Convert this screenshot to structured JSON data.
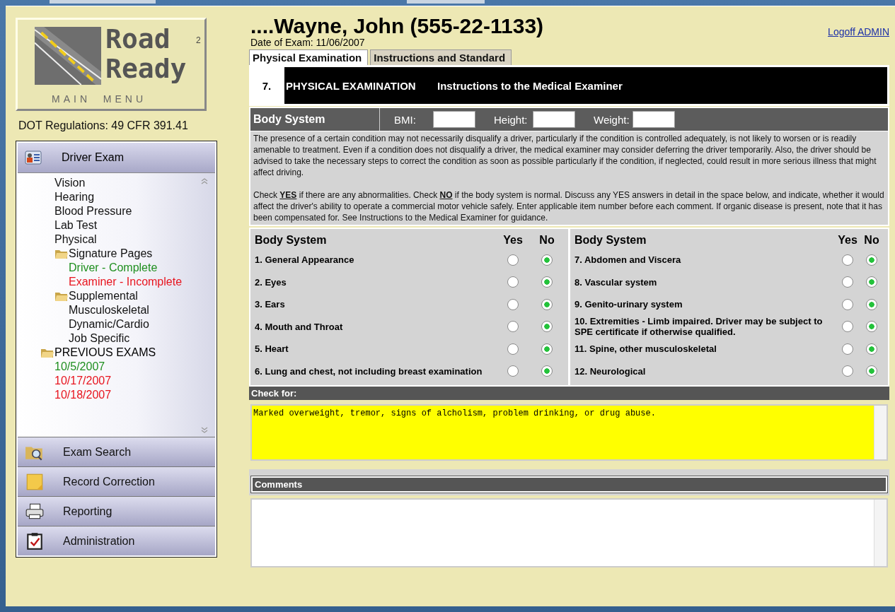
{
  "logo": {
    "line_1": "Road",
    "line_2": "Ready",
    "superscript": "2",
    "caption": "MAIN  MENU"
  },
  "regulation": "DOT Regulations: 49 CFR 391.41",
  "nav": {
    "header": "Driver Exam",
    "exam_items": [
      {
        "label": "Vision"
      },
      {
        "label": "Hearing"
      },
      {
        "label": "Blood Pressure"
      },
      {
        "label": "Lab Test"
      },
      {
        "label": "Physical"
      },
      {
        "label": "Signature Pages",
        "kind": "folder",
        "children": [
          {
            "label": "Driver - Complete",
            "color": "#1f8f1f"
          },
          {
            "label": "Examiner - Incomplete",
            "color": "#e8141e"
          }
        ]
      },
      {
        "label": "Supplemental",
        "kind": "folder",
        "children": [
          {
            "label": "Musculoskeletal"
          },
          {
            "label": "Dynamic/Cardio"
          },
          {
            "label": "Job Specific"
          }
        ]
      }
    ],
    "previous_exams": {
      "label": "PREVIOUS EXAMS",
      "children": [
        {
          "label": "10/5/2007",
          "color": "#1f8f1f"
        },
        {
          "label": "10/17/2007",
          "color": "#e8141e"
        },
        {
          "label": "10/18/2007",
          "color": "#e8141e"
        }
      ]
    },
    "buttons": [
      {
        "label": "Exam Search",
        "kind": "search"
      },
      {
        "label": "Record Correction",
        "kind": "note"
      },
      {
        "label": "Reporting",
        "kind": "printer"
      },
      {
        "label": "Administration",
        "kind": "clipboard"
      }
    ]
  },
  "patient": {
    "name": "....Wayne, John (555-22-1133)",
    "exam_date": "Date of Exam: 11/06/2007"
  },
  "logoff": "Logoff ADMIN",
  "tabs": [
    {
      "label": "Physical Examination",
      "selected": true
    },
    {
      "label": "Instructions and Standard",
      "selected": false
    }
  ],
  "banner": {
    "number": "7.",
    "title": "PHYSICAL EXAMINATION",
    "subtitle": "Instructions to the Medical Examiner"
  },
  "measures": {
    "heading": "Body System",
    "fields": [
      {
        "label": "BMI:"
      },
      {
        "label": "Height:"
      },
      {
        "label": "Weight:"
      }
    ]
  },
  "instructions": [
    "The presence of a certain condition may not necessarily disqualify a driver, particularly if the condition is controlled adequately, is not likely to worsen or is readily amenable to treatment. Even if a condition does not disqualify a driver, the medical examiner may consider deferring the driver temporarily. Also, the driver should be advised to take the necessary steps to correct the condition as soon as possible particularly if the condition, if neglected, could result in more serious illness that might affect driving.",
    "Check **YES** if there are any abnormalities. Check **NO** if the body system is normal. Discuss any YES answers in detail in the space below, and indicate, whether it would affect the driver's ability to operate a commercial motor vehicle safely. Enter applicable item number before each comment. If organic disease is present, note that it has been compensated for. See Instructions to the Medical Examiner for guidance."
  ],
  "panels": [
    {
      "heading": "Body System",
      "yes": "Yes",
      "no": "No",
      "rows": [
        {
          "label": "1. General Appearance",
          "yes": false,
          "no": true
        },
        {
          "label": "2. Eyes",
          "yes": false,
          "no": true
        },
        {
          "label": "3. Ears",
          "yes": false,
          "no": true
        },
        {
          "label": "4. Mouth and Throat",
          "yes": false,
          "no": true
        },
        {
          "label": "5. Heart",
          "yes": false,
          "no": true
        },
        {
          "label": "6. Lung and chest, not including breast examination",
          "yes": false,
          "no": true
        }
      ]
    },
    {
      "heading": "Body System",
      "yes": "Yes",
      "no": "No",
      "rows": [
        {
          "label": "7. Abdomen and Viscera",
          "yes": false,
          "no": true
        },
        {
          "label": "8. Vascular system",
          "yes": false,
          "no": true
        },
        {
          "label": "9. Genito-urinary system",
          "yes": false,
          "no": true
        },
        {
          "label": "10. Extremities - Limb impaired. Driver may be subject to SPE certificate if otherwise qualified.",
          "yes": false,
          "no": true
        },
        {
          "label": "11.  Spine, other musculoskeletal",
          "yes": false,
          "no": true
        },
        {
          "label": "12. Neurological",
          "yes": false,
          "no": true
        }
      ]
    }
  ],
  "check_for": {
    "heading": "Check for:",
    "value": "Marked overweight, tremor, signs of alcholism, problem drinking, or drug abuse."
  },
  "comments": {
    "heading": "Comments"
  }
}
